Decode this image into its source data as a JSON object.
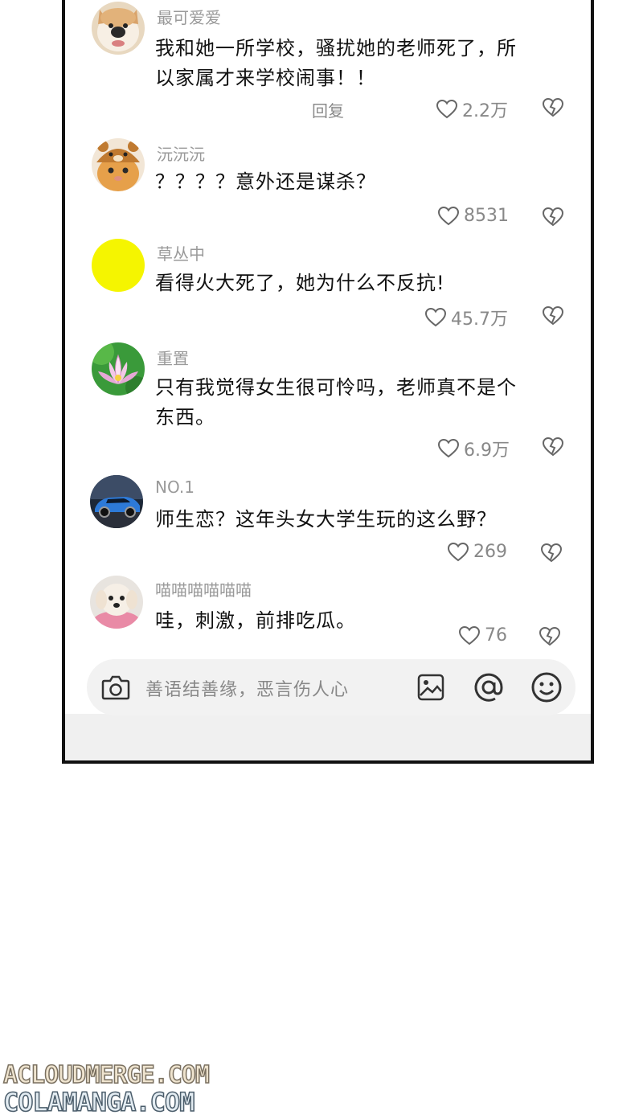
{
  "comments": [
    {
      "username": "最可爱爱",
      "text_lines": [
        "我和她一所学校，骚扰她的老师死了，所",
        "以家属才来学校闹事！！"
      ],
      "reply": "回复",
      "likes": "2.2万",
      "avatar": "dog-avatar"
    },
    {
      "username": "沅沅沅",
      "text_lines": [
        "？？？？意外还是谋杀？"
      ],
      "likes": "8531",
      "avatar": "cat-bear-hat-avatar"
    },
    {
      "username": "草丛中",
      "text_lines": [
        "看得火大死了，她为什么不反抗!"
      ],
      "likes": "45.7万",
      "avatar": "yellow-circle-avatar"
    },
    {
      "username": "重置",
      "text_lines": [
        "只有我觉得女生很可怜吗，老师真不是个",
        "东西。"
      ],
      "likes": "6.9万",
      "avatar": "lotus-avatar"
    },
    {
      "username": "NO.1",
      "text_lines": [
        "师生恋？这年头女大学生玩的这么野？"
      ],
      "likes": "269",
      "avatar": "sports-car-avatar"
    },
    {
      "username": "喵喵喵喵喵喵",
      "text_lines": [
        "哇，刺激，前排吃瓜。"
      ],
      "likes": "76",
      "avatar": "puppy-avatar"
    }
  ],
  "input_bar": {
    "placeholder": "善语结善缘，恶言伤人心"
  },
  "watermarks": [
    "ACLOUDMERGE.COM",
    "COLAMANGA.COM"
  ],
  "colors": {
    "yellow_avatar": "#f5f500",
    "muted_text": "#9a9a9a"
  }
}
